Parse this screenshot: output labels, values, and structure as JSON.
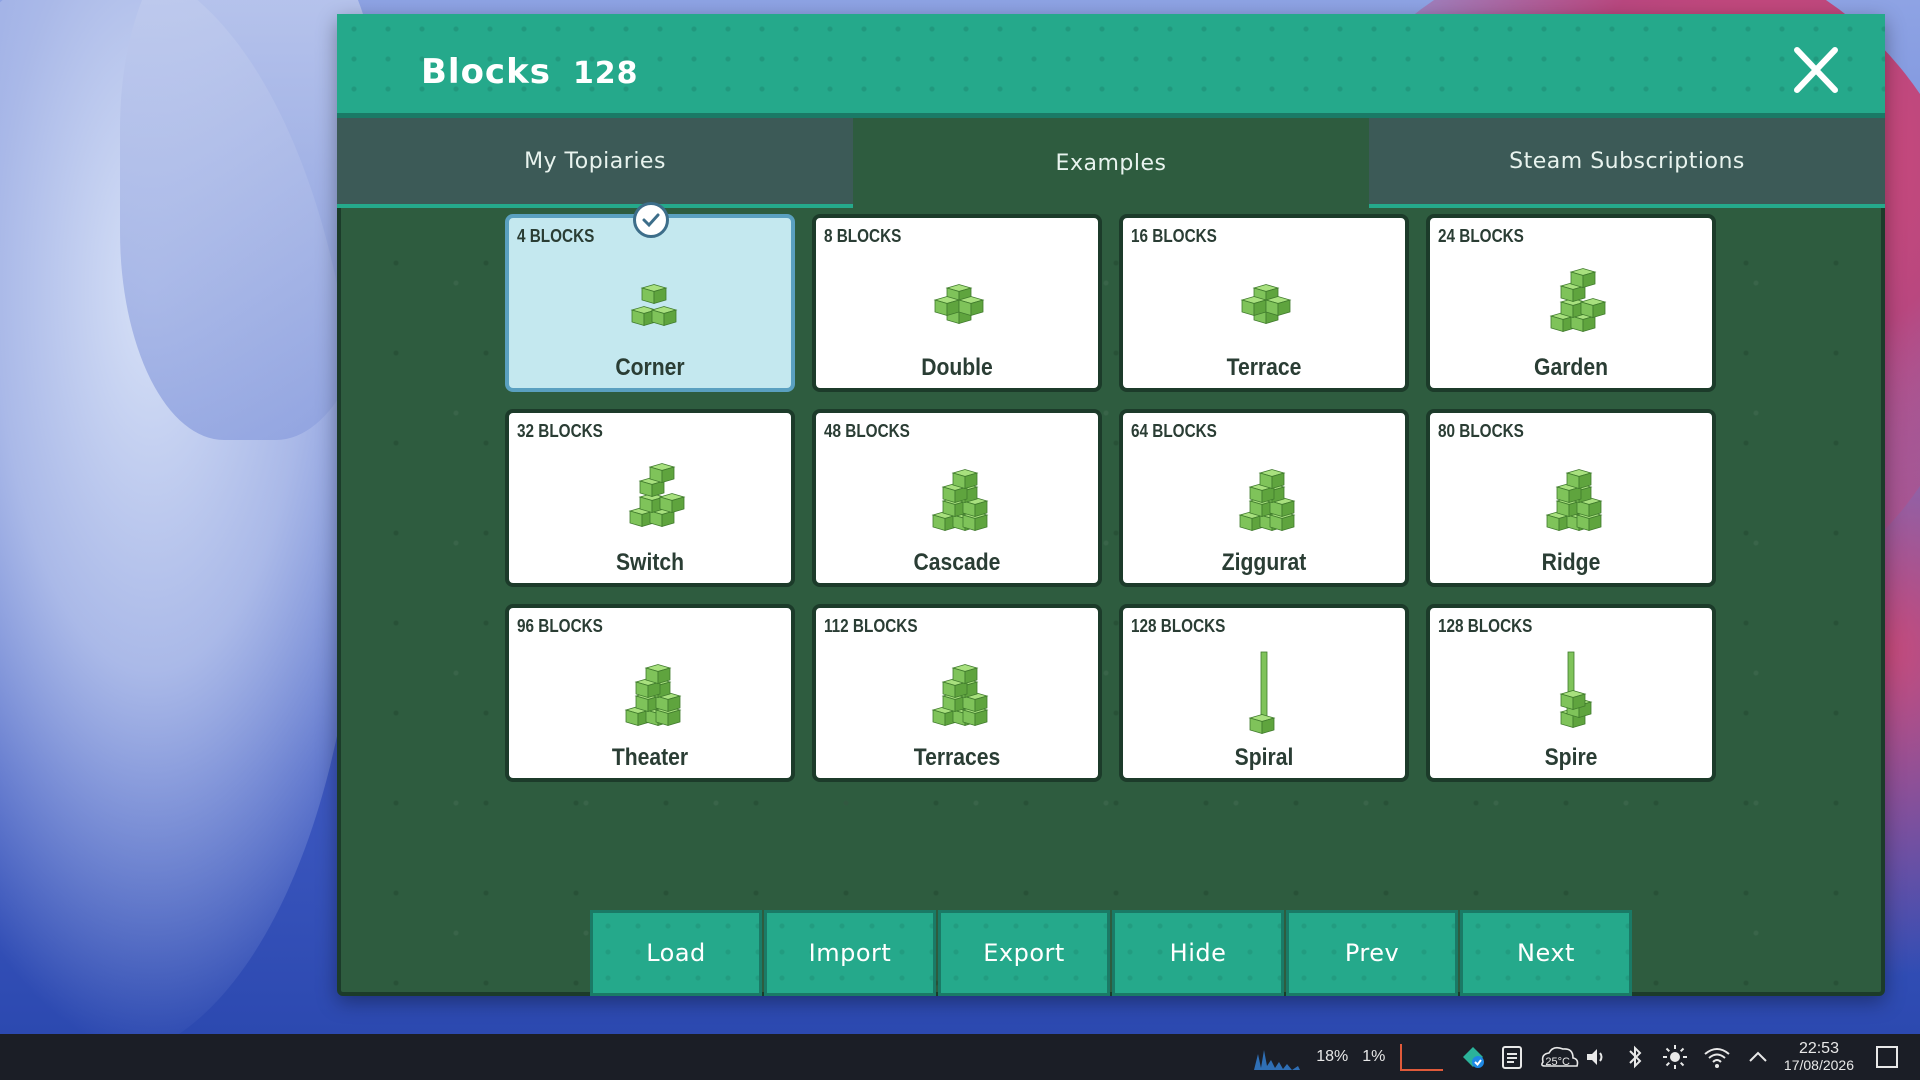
{
  "header": {
    "title": "Blocks",
    "block_count": "128"
  },
  "tabs": [
    {
      "label": "My Topiaries",
      "active": false
    },
    {
      "label": "Examples",
      "active": true
    },
    {
      "label": "Steam Subscriptions",
      "active": false
    }
  ],
  "cards": [
    {
      "blocks": "4 BLOCKS",
      "name": "Corner",
      "selected": true
    },
    {
      "blocks": "8 BLOCKS",
      "name": "Double"
    },
    {
      "blocks": "16 BLOCKS",
      "name": "Terrace"
    },
    {
      "blocks": "24 BLOCKS",
      "name": "Garden"
    },
    {
      "blocks": "32 BLOCKS",
      "name": "Switch"
    },
    {
      "blocks": "48 BLOCKS",
      "name": "Cascade"
    },
    {
      "blocks": "64 BLOCKS",
      "name": "Ziggurat"
    },
    {
      "blocks": "80 BLOCKS",
      "name": "Ridge"
    },
    {
      "blocks": "96 BLOCKS",
      "name": "Theater"
    },
    {
      "blocks": "112 BLOCKS",
      "name": "Terraces"
    },
    {
      "blocks": "128 BLOCKS",
      "name": "Spiral"
    },
    {
      "blocks": "128 BLOCKS",
      "name": "Spire"
    }
  ],
  "buttons": {
    "load": "Load",
    "import": "Import",
    "export": "Export",
    "hide": "Hide",
    "prev": "Prev",
    "next": "Next"
  },
  "taskbar": {
    "cpu": "18%",
    "mem": "1%",
    "temp": "25°C",
    "time": "22:53",
    "date": "17/08/2026"
  },
  "colors": {
    "header": "#25a98b",
    "panel": "#2e5c3f",
    "card_selected": "#c4e8ef",
    "block_green": "#8fd36a"
  }
}
